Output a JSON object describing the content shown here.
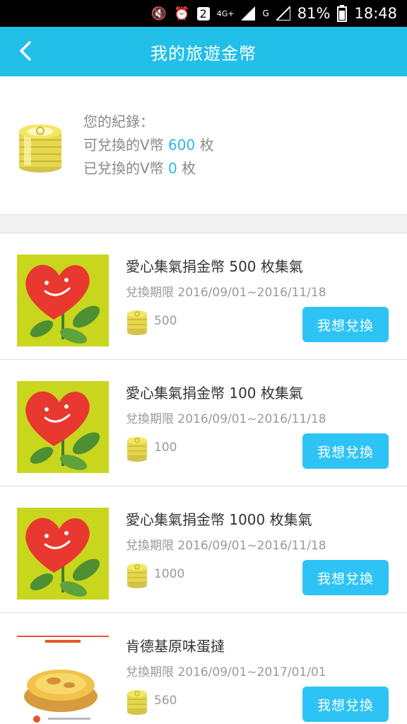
{
  "status": {
    "battery": "81%",
    "time": "18:48",
    "sim": "2",
    "network": "4G+",
    "network2": "G"
  },
  "header": {
    "title": "我的旅遊金幣"
  },
  "summary": {
    "heading": "您的紀錄：",
    "available_label": "可兌換的V幣",
    "available_value": "600",
    "available_unit": "枚",
    "redeemed_label": "已兌換的V幣",
    "redeemed_value": "0",
    "redeemed_unit": "枚"
  },
  "items": [
    {
      "title": "愛心集氣捐金幣 500 枚集氣",
      "period": "兌換期限 2016/09/01~2016/11/18",
      "coins": "500",
      "button": "我想兌換"
    },
    {
      "title": "愛心集氣捐金幣 100 枚集氣",
      "period": "兌換期限 2016/09/01~2016/11/18",
      "coins": "100",
      "button": "我想兌換"
    },
    {
      "title": "愛心集氣捐金幣 1000 枚集氣",
      "period": "兌換期限 2016/09/01~2016/11/18",
      "coins": "1000",
      "button": "我想兌換"
    },
    {
      "title": "肯德基原味蛋撻",
      "period": "兌換期限 2016/09/01~2017/01/01",
      "coins": "560",
      "button": "我想兌換"
    }
  ],
  "colors": {
    "header": "#22bfe8",
    "accent": "#2cb7ea",
    "button": "#2ec3f5"
  },
  "icons": {
    "back": "chevron-left-icon",
    "coin": "coin-icon"
  }
}
